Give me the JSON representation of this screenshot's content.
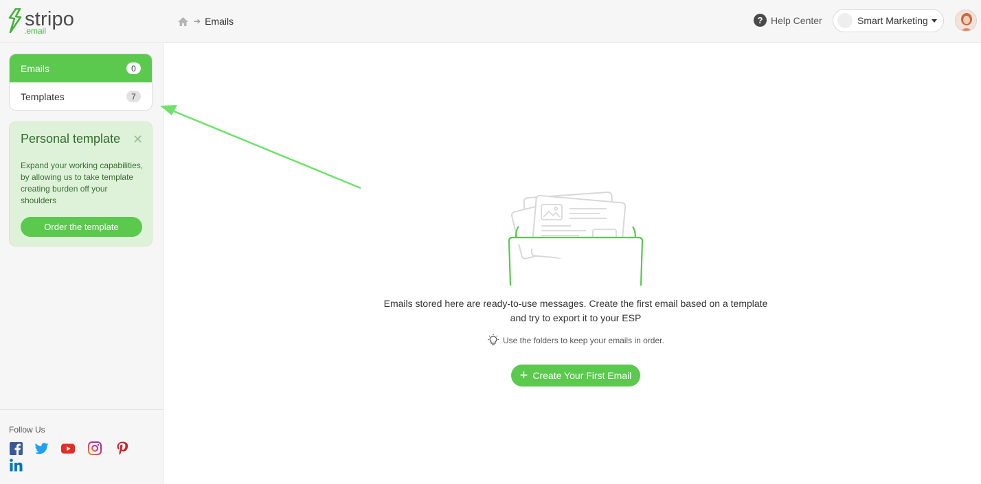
{
  "brand": {
    "name": "stripo",
    "sub": ".email",
    "accent": "#5ac94e"
  },
  "header": {
    "breadcrumb": {
      "home_icon": "home-icon",
      "current": "Emails"
    },
    "help_label": "Help Center",
    "account_name": "Smart Marketing"
  },
  "sidebar": {
    "nav": [
      {
        "label": "Emails",
        "count": "0",
        "active": true
      },
      {
        "label": "Templates",
        "count": "7",
        "active": false
      }
    ],
    "promo": {
      "title": "Personal template",
      "text": "Expand your working capabilities, by allowing us to take template creating burden off your shoulders",
      "button": "Order the template"
    },
    "follow_label": "Follow Us",
    "social": [
      "facebook-icon",
      "twitter-icon",
      "youtube-icon",
      "instagram-icon",
      "pinterest-icon",
      "linkedin-icon"
    ]
  },
  "main": {
    "empty_line1": "Emails stored here are ready-to-use messages. Create the first email based on a template",
    "empty_line2": "and try to export it to your ESP",
    "tip": "Use the folders to keep your emails in order.",
    "create_button": "Create Your First Email"
  }
}
